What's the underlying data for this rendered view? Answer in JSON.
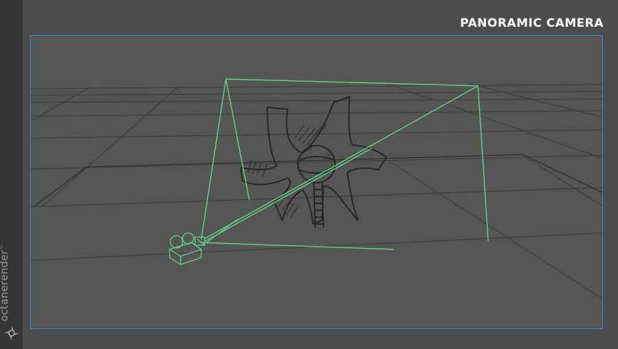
{
  "title": "PANORAMIC CAMERA",
  "brand": {
    "name": "octanerender",
    "trademark": "™",
    "logo_icon": "octane-logo-icon"
  },
  "viewport": {
    "frame_color": "#2f8fd6",
    "camera_wire_color": "#5fd68a",
    "sketch_color": "#2b2b2b",
    "grid_color": "#3a3a3a",
    "objects": [
      "panoramic-camera-icon",
      "frustum-wireframe",
      "shutter-sculpture-sketch",
      "sphere-sketch",
      "ladder-sketch",
      "ground-grid"
    ]
  }
}
